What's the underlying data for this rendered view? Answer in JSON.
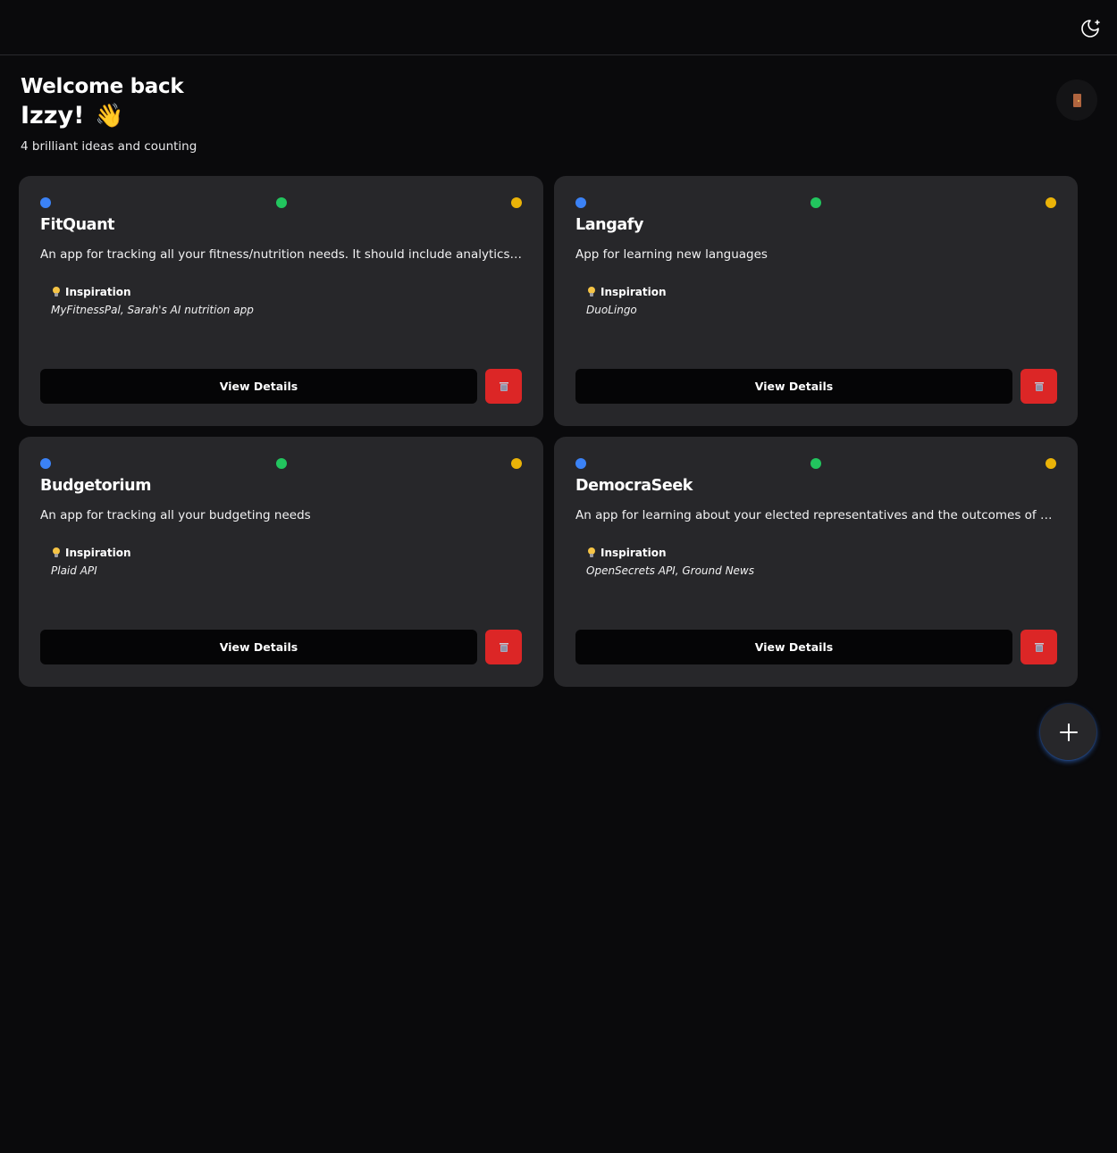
{
  "header": {
    "theme_toggle_icon": "moon-sparkle-icon"
  },
  "welcome": {
    "line1": "Welcome back",
    "name": "Izzy!",
    "wave": "👋",
    "subtitle": "4 brilliant ideas and counting"
  },
  "logout_icon": "door-icon",
  "colors": {
    "background": "#0a0a0c",
    "card": "#27272a",
    "dot_blue": "#3b82f6",
    "dot_green": "#22c55e",
    "dot_yellow": "#eab308",
    "delete": "#dc2626",
    "button": "#050506"
  },
  "ideas": [
    {
      "title": "FitQuant",
      "description": "An app for tracking all your fitness/nutrition needs. It should include analytics, tracker...",
      "inspiration_label": "Inspiration",
      "inspiration": "MyFitnessPal, Sarah's AI nutrition app",
      "view_label": "View Details"
    },
    {
      "title": "Langafy",
      "description": "App for learning new languages",
      "inspiration_label": "Inspiration",
      "inspiration": "DuoLingo",
      "view_label": "View Details"
    },
    {
      "title": "Budgetorium",
      "description": "An app for tracking all your budgeting needs",
      "inspiration_label": "Inspiration",
      "inspiration": "Plaid API",
      "view_label": "View Details"
    },
    {
      "title": "DemocraSeek",
      "description": "An app for learning about your elected representatives and the outcomes of their pol...",
      "inspiration_label": "Inspiration",
      "inspiration": "OpenSecrets API, Ground News",
      "view_label": "View Details"
    }
  ],
  "fab_icon": "plus-icon"
}
